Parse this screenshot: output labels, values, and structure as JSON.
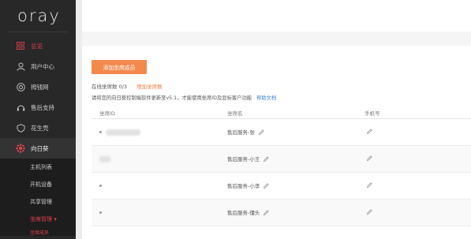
{
  "logo": {
    "text": "oray"
  },
  "colors": {
    "sidebar": "#282828",
    "accent_red": "#e0424d",
    "button_orange": "#f4894d",
    "link_orange": "#f07b3f",
    "link_blue": "#3d82d6"
  },
  "sidebar": {
    "items": [
      {
        "label": "总览",
        "icon": "grid-icon",
        "active": true
      },
      {
        "label": "用户中心",
        "icon": "user-icon"
      },
      {
        "label": "拇钱网",
        "icon": "circle-icon"
      },
      {
        "label": "售后支持",
        "icon": "headset-icon"
      },
      {
        "label": "花生壳",
        "icon": "shield-icon"
      },
      {
        "label": "向日葵",
        "icon": "sunflower-icon",
        "expanded": true
      }
    ],
    "sub_items": [
      {
        "label": "主机列表"
      },
      {
        "label": "开机设备"
      },
      {
        "label": "共享管理"
      },
      {
        "label": "坐席管理 ▾",
        "active": true
      },
      {
        "label": "坐席成员",
        "active": true
      }
    ]
  },
  "main": {
    "add_button": "添加坐席成员",
    "stats_label": "在线坐席数 0/3",
    "add_seats_link": "增加坐席数",
    "notice": "请将您的向日葵控制端软件更新至v5.1，才能使用坐席ID及显标客户功能",
    "help_link": "帮助文档",
    "table": {
      "headers": [
        "坐席ID",
        "坐席名",
        "手机号"
      ],
      "rows": [
        {
          "id": "",
          "name": "售后服务-张"
        },
        {
          "id": "",
          "name": "售后服务-小王"
        },
        {
          "id": "",
          "name": "售后服务-小李"
        },
        {
          "id": "",
          "name": "售后服务-懂头"
        }
      ]
    }
  }
}
